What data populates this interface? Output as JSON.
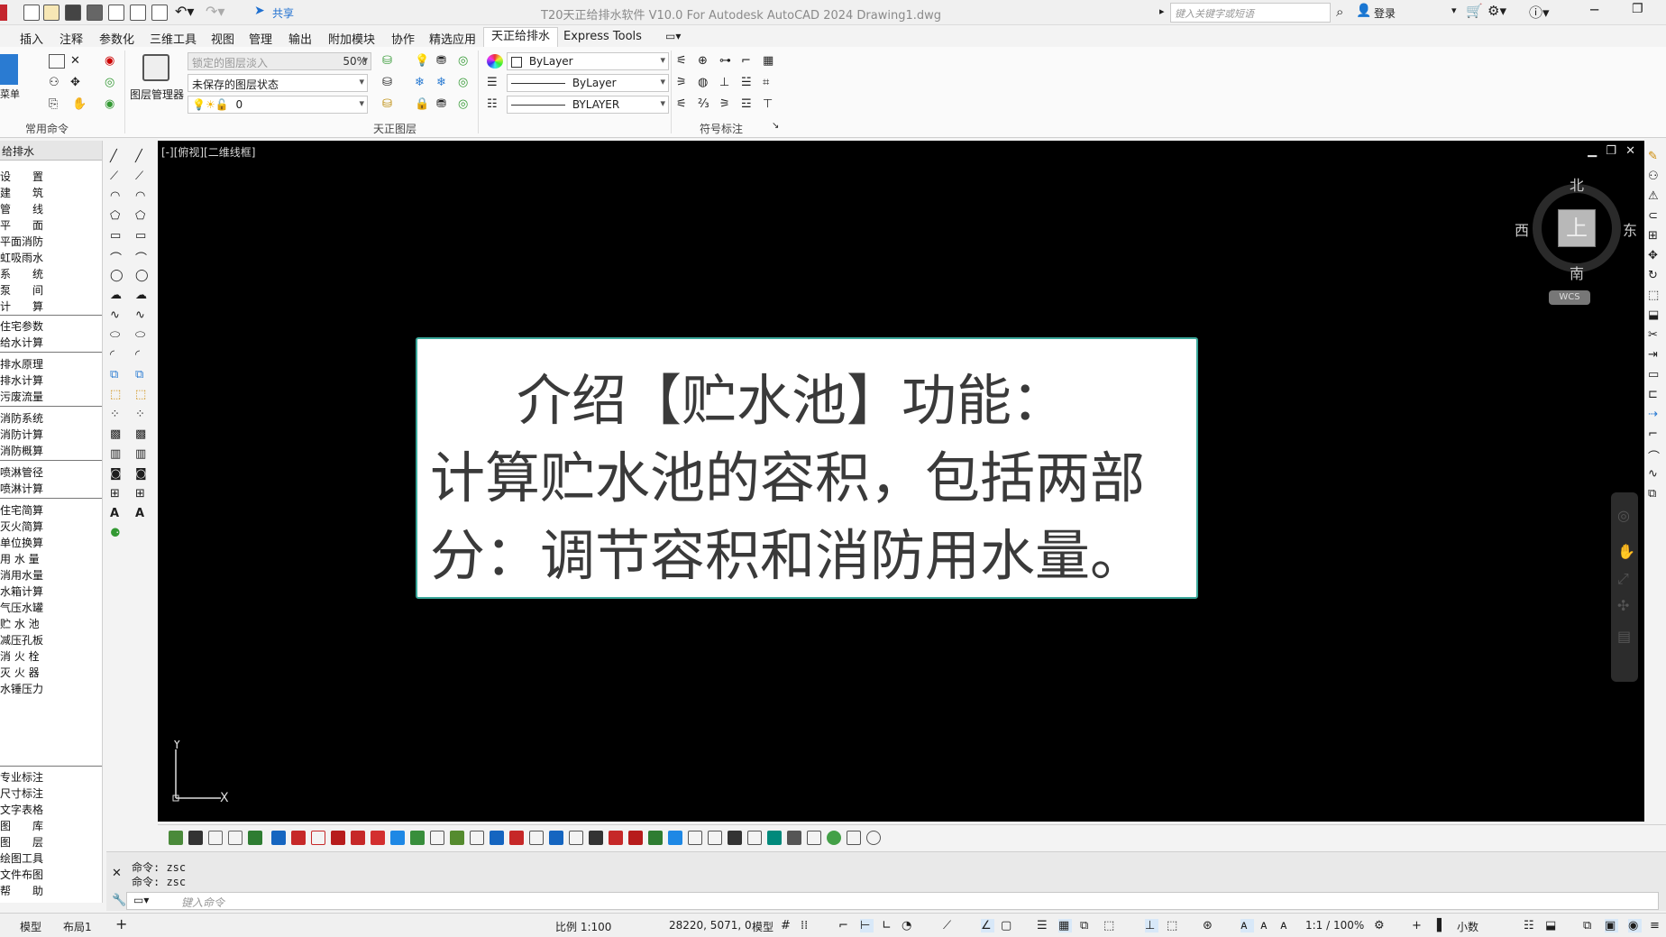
{
  "window": {
    "title": "T20天正给排水软件 V10.0 For Autodesk AutoCAD 2024    Drawing1.dwg",
    "share_label": "共享",
    "search_placeholder": "键入关键字或短语",
    "login_label": "登录"
  },
  "menu": {
    "items": [
      "插入",
      "注释",
      "参数化",
      "三维工具",
      "视图",
      "管理",
      "输出",
      "附加模块",
      "协作",
      "精选应用",
      "天正给排水",
      "Express Tools"
    ],
    "active": "天正给排水"
  },
  "ribbon": {
    "panel1_label": "常用命令",
    "panel1_menu_label": "菜单",
    "layer_manager_label": "图层管理器",
    "layer_fade_label": "锁定的图层淡入",
    "layer_fade_value": "50%",
    "layer_state": "未保存的图层状态",
    "current_layer": "0",
    "panel2_label": "天正图层",
    "color_combo": "ByLayer",
    "linetype_combo": "ByLayer",
    "lineweight_combo": "BYLAYER",
    "panel3_label": "符号标注"
  },
  "left_panel": {
    "header": "给排水",
    "items": [
      "设　　置",
      "建　　筑",
      "管　　线",
      "平　　面",
      "平面消防",
      "虹吸雨水",
      "系　　统",
      "泵　　间",
      "计　　算",
      "住宅参数",
      "给水计算",
      "排水原理",
      "排水计算",
      "污废流量",
      "消防系统",
      "消防计算",
      "消防概算",
      "喷淋管径",
      "喷淋计算",
      "住宅简算",
      "灭火简算",
      "单位换算",
      "用 水 量",
      "消用水量",
      "水箱计算",
      "气压水罐",
      "贮 水 池",
      "减压孔板",
      "消 火 栓",
      "灭 火 器",
      "水锤压力",
      "专业标注",
      "尺寸标注",
      "文字表格",
      "图　　库",
      "图　　层",
      "绘图工具",
      "文件布图",
      "帮　　助"
    ]
  },
  "viewport": {
    "label": "[-][俯视][二维线框]",
    "overlay_lines": [
      "介绍【贮水池】功能：",
      "计算贮水池的容积，包括两部",
      "分：调节容积和消防用水量。"
    ],
    "viewcube": {
      "north": "北",
      "south": "南",
      "east": "东",
      "west": "西",
      "face": "上",
      "wcs": "WCS"
    },
    "ucs_x": "X",
    "ucs_y": "Y"
  },
  "command": {
    "history": [
      "命令: zsc",
      "命令: zsc"
    ],
    "placeholder": "键入命令"
  },
  "status": {
    "tab_model": "模型",
    "tab_layout1": "布局1",
    "scale": "比例 1:100",
    "coords": "28220, 5071, 0",
    "model_label": "模型",
    "annotation_scale": "1:1 / 100%",
    "units": "小数"
  },
  "colors": {
    "accent": "#3aa79a",
    "viewport_bg": "#000000",
    "overlay_text": "#3a3a3a"
  }
}
